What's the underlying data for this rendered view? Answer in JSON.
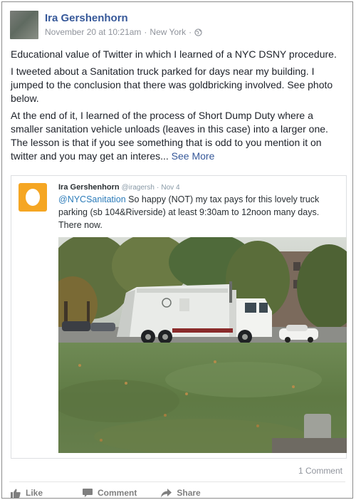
{
  "post": {
    "author": "Ira Gershenhorn",
    "date": "November 20 at 10:21am",
    "separator": "·",
    "location": "New York",
    "separator2": "·",
    "privacy_icon": "globe-icon",
    "paragraphs": [
      "Educational value of Twitter in which I learned of a NYC DSNY procedure.",
      "I tweeted about a Sanitation truck parked for days near my building. I jumped to the conclusion that there was goldbricking involved. See photo below.",
      "At the end of it, I learned of the process of Short Dump Duty where a smaller sanitation vehicle unloads (leaves in this case) into a larger one. The lesson is that if you see something that is odd to you mention it on twitter and you may get an interes..."
    ],
    "see_more": "See More"
  },
  "tweet": {
    "name": "Ira Gershenhorn",
    "handle": "@iragersh",
    "separator": "·",
    "date": "Nov 4",
    "mention": "@NYCSanitation",
    "text": " So happy (NOT) my tax pays for this lovely truck parking (sb 104&Riverside) at least 9:30am to 12noon many days. There now."
  },
  "footer": {
    "comment_count": "1 Comment",
    "like_label": "Like",
    "comment_label": "Comment",
    "share_label": "Share"
  },
  "colors": {
    "link": "#365899",
    "meta": "#90949c",
    "tweet_mention": "#2b7bb9",
    "tweet_avatar": "#f5a623"
  }
}
